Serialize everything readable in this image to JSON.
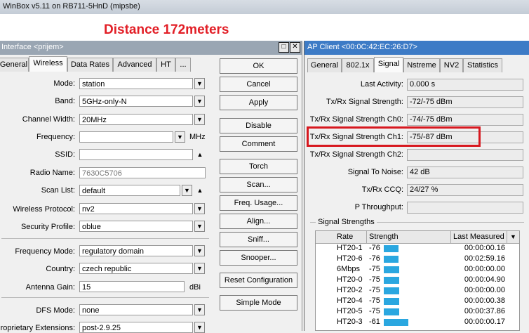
{
  "app_title": "WinBox v5.11 on RB711-5HnD (mipsbe)",
  "annotation": "Distance 172meters",
  "left_window": {
    "title": "Interface <prijem>",
    "tabs": [
      "General",
      "Wireless",
      "Data Rates",
      "Advanced",
      "HT",
      "..."
    ],
    "selected_tab": "Wireless",
    "fields": {
      "mode": {
        "label": "Mode:",
        "value": "station"
      },
      "band": {
        "label": "Band:",
        "value": "5GHz-only-N"
      },
      "channel_width": {
        "label": "Channel Width:",
        "value": "20MHz"
      },
      "frequency": {
        "label": "Frequency:",
        "value": "",
        "unit": "MHz"
      },
      "ssid": {
        "label": "SSID:",
        "value": ""
      },
      "radio_name": {
        "label": "Radio Name:",
        "value": "7630C5706"
      },
      "scan_list": {
        "label": "Scan List:",
        "value": "default"
      },
      "wireless_protocol": {
        "label": "Wireless Protocol:",
        "value": "nv2"
      },
      "security_profile": {
        "label": "Security Profile:",
        "value": "oblue"
      },
      "frequency_mode": {
        "label": "Frequency Mode:",
        "value": "regulatory domain"
      },
      "country": {
        "label": "Country:",
        "value": "czech republic"
      },
      "antenna_gain": {
        "label": "Antenna Gain:",
        "value": "15",
        "unit": "dBi"
      },
      "dfs_mode": {
        "label": "DFS Mode:",
        "value": "none"
      },
      "proprietary_extensions": {
        "label": "Proprietary Extensions:",
        "value": "post-2.9.25"
      }
    },
    "buttons": [
      "OK",
      "Cancel",
      "Apply",
      "Disable",
      "Comment",
      "Torch",
      "Scan...",
      "Freq. Usage...",
      "Align...",
      "Sniff...",
      "Snooper...",
      "Reset Configuration",
      "Simple Mode"
    ]
  },
  "right_window": {
    "title": "AP Client <00:0C:42:EC:26:D7>",
    "tabs": [
      "General",
      "802.1x",
      "Signal",
      "Nstreme",
      "NV2",
      "Statistics"
    ],
    "selected_tab": "Signal",
    "stats": {
      "last_activity": {
        "label": "Last Activity:",
        "value": "0.000 s"
      },
      "txrx_signal": {
        "label": "Tx/Rx Signal Strength:",
        "value": "-72/-75 dBm"
      },
      "txrx_ch0": {
        "label": "Tx/Rx Signal Strength Ch0:",
        "value": "-74/-75 dBm"
      },
      "txrx_ch1": {
        "label": "Tx/Rx Signal Strength Ch1:",
        "value": "-75/-87 dBm"
      },
      "txrx_ch2": {
        "label": "Tx/Rx Signal Strength Ch2:",
        "value": ""
      },
      "snr": {
        "label": "Signal To Noise:",
        "value": "42 dB"
      },
      "ccq": {
        "label": "Tx/Rx CCQ:",
        "value": "24/27 %"
      },
      "p_throughput": {
        "label": "P Throughput:",
        "value": ""
      }
    },
    "section_label": "Signal Strengths",
    "table": {
      "headers": [
        "Rate",
        "Strength",
        "Last Measured"
      ],
      "rows": [
        {
          "rate": "HT20-1",
          "strength": "-76",
          "last": "00:00:00.16",
          "level": 0.26
        },
        {
          "rate": "HT20-6",
          "strength": "-76",
          "last": "00:02:59.16",
          "level": 0.26
        },
        {
          "rate": "6Mbps",
          "strength": "-75",
          "last": "00:00:00.00",
          "level": 0.28
        },
        {
          "rate": "HT20-0",
          "strength": "-75",
          "last": "00:00:04.90",
          "level": 0.28
        },
        {
          "rate": "HT20-2",
          "strength": "-75",
          "last": "00:00:00.00",
          "level": 0.28
        },
        {
          "rate": "HT20-4",
          "strength": "-75",
          "last": "00:00:00.38",
          "level": 0.28
        },
        {
          "rate": "HT20-5",
          "strength": "-75",
          "last": "00:00:37.86",
          "level": 0.28
        },
        {
          "rate": "HT20-3",
          "strength": "-61",
          "last": "00:00:00.17",
          "level": 0.44
        }
      ]
    }
  },
  "colors": {
    "highlight": "#d7181f",
    "bar": "#2aa7e0",
    "annotation": "#e21e26"
  }
}
